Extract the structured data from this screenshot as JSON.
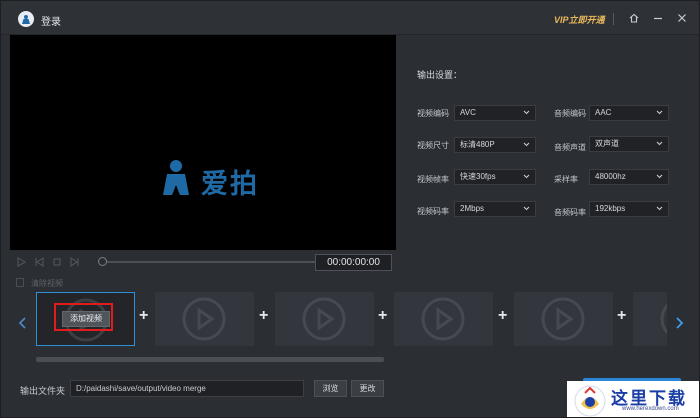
{
  "titlebar": {
    "title": "登录",
    "vip_label": "VIP立即开通",
    "vip_color": "#e8b85a",
    "icons": [
      "app-logo-icon",
      "home-icon",
      "minimize-icon",
      "close-icon"
    ]
  },
  "preview": {
    "brand_text": "爱拍",
    "brand_color": "#1f6aa5",
    "time": "00:00:00:00"
  },
  "settings": {
    "title": "输出设置：",
    "video_codec": {
      "label": "视频编码",
      "value": "AVC"
    },
    "video_size": {
      "label": "视频尺寸",
      "value": "标清480P"
    },
    "video_fps": {
      "label": "视频帧率",
      "value": "快速30fps"
    },
    "video_bitrate": {
      "label": "视频码率",
      "value": "2Mbps"
    },
    "audio_codec": {
      "label": "音频编码",
      "value": "AAC"
    },
    "audio_channel": {
      "label": "音频声道",
      "value": "双声道"
    },
    "sample_rate": {
      "label": "采样率",
      "value": "48000hz"
    },
    "audio_bitrate": {
      "label": "音频码率",
      "value": "192kbps"
    }
  },
  "timeline": {
    "clear_label": "清除视频",
    "add_video_label": "添加视频",
    "plus": "+",
    "accent": "#2f8fd6"
  },
  "output": {
    "folder_label": "输出文件夹",
    "path": "D:/paidashi/save/output/video merge",
    "browse_label": "浏览",
    "change_label": "更改",
    "export_color": "#2c86d8"
  },
  "watermark": {
    "text": "这里下载",
    "url": "www.herexdown.com"
  }
}
